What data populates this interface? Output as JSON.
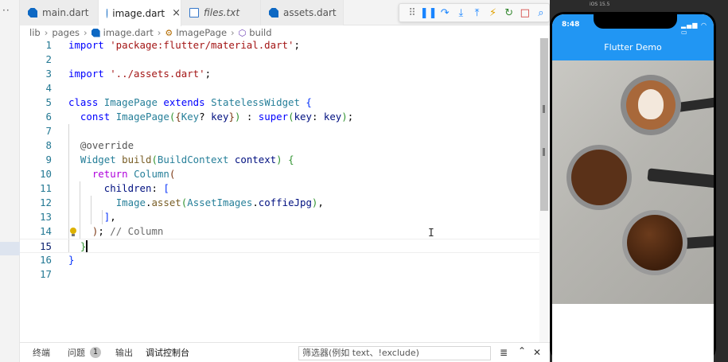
{
  "activity_bar": {
    "more": "··"
  },
  "tabs": [
    {
      "label": "main.dart",
      "icon": "dart-icon",
      "active": false,
      "italic": false
    },
    {
      "label": "image.dart",
      "icon": "dart-icon",
      "active": true,
      "italic": false,
      "close": "×"
    },
    {
      "label": "files.txt",
      "icon": "file-icon",
      "active": false,
      "italic": true
    },
    {
      "label": "assets.dart",
      "icon": "dart-icon",
      "active": false,
      "italic": false
    }
  ],
  "debug_toolbar": {
    "buttons": [
      {
        "name": "drag-handle-icon",
        "glyph": "⠿",
        "color": "#888888"
      },
      {
        "name": "pause-icon",
        "glyph": "❚❚",
        "color": "#1a85ff"
      },
      {
        "name": "step-over-icon",
        "glyph": "↷",
        "color": "#1a85ff"
      },
      {
        "name": "step-into-icon",
        "glyph": "⤓",
        "color": "#1a85ff"
      },
      {
        "name": "step-out-icon",
        "glyph": "⤒",
        "color": "#1a85ff"
      },
      {
        "name": "hot-reload-icon",
        "glyph": "⚡",
        "color": "#e0a000"
      },
      {
        "name": "restart-icon",
        "glyph": "↻",
        "color": "#388a34"
      },
      {
        "name": "stop-icon",
        "glyph": "□",
        "color": "#d0312d"
      },
      {
        "name": "inspect-icon",
        "glyph": "⌕",
        "color": "#1a85ff"
      }
    ]
  },
  "breadcrumb": {
    "items": [
      "lib",
      "pages",
      "image.dart",
      "ImagePage",
      "build"
    ],
    "separator": "›"
  },
  "code_lines": [
    {
      "num": "1",
      "tokens": [
        {
          "t": "import ",
          "c": "kw"
        },
        {
          "t": "'package:flutter/material.dart'",
          "c": "str"
        },
        {
          "t": ";",
          "c": ""
        }
      ]
    },
    {
      "num": "2",
      "tokens": []
    },
    {
      "num": "3",
      "tokens": [
        {
          "t": "import ",
          "c": "kw"
        },
        {
          "t": "'../assets.dart'",
          "c": "str"
        },
        {
          "t": ";",
          "c": ""
        }
      ]
    },
    {
      "num": "4",
      "tokens": []
    },
    {
      "num": "5",
      "tokens": [
        {
          "t": "class ",
          "c": "kw"
        },
        {
          "t": "ImagePage ",
          "c": "ty"
        },
        {
          "t": "extends ",
          "c": "kw"
        },
        {
          "t": "StatelessWidget ",
          "c": "ty"
        },
        {
          "t": "{",
          "c": "br1"
        }
      ]
    },
    {
      "num": "6",
      "tokens": [
        {
          "t": "  ",
          "c": ""
        },
        {
          "t": "const ",
          "c": "kw"
        },
        {
          "t": "ImagePage",
          "c": "ty"
        },
        {
          "t": "(",
          "c": "br2"
        },
        {
          "t": "{",
          "c": "br3"
        },
        {
          "t": "Key",
          "c": "ty"
        },
        {
          "t": "? ",
          "c": ""
        },
        {
          "t": "key",
          "c": "pm"
        },
        {
          "t": "}",
          "c": "br3"
        },
        {
          "t": ")",
          "c": "br2"
        },
        {
          "t": " : ",
          "c": ""
        },
        {
          "t": "super",
          "c": "kw"
        },
        {
          "t": "(",
          "c": "br2"
        },
        {
          "t": "key",
          "c": "pm"
        },
        {
          "t": ": ",
          "c": ""
        },
        {
          "t": "key",
          "c": "pm"
        },
        {
          "t": ")",
          "c": "br2"
        },
        {
          "t": ";",
          "c": ""
        }
      ]
    },
    {
      "num": "7",
      "tokens": []
    },
    {
      "num": "8",
      "tokens": [
        {
          "t": "  ",
          "c": ""
        },
        {
          "t": "@override",
          "c": "ann"
        }
      ]
    },
    {
      "num": "9",
      "tokens": [
        {
          "t": "  ",
          "c": ""
        },
        {
          "t": "Widget ",
          "c": "ty"
        },
        {
          "t": "build",
          "c": "fn"
        },
        {
          "t": "(",
          "c": "br2"
        },
        {
          "t": "BuildContext ",
          "c": "ty"
        },
        {
          "t": "context",
          "c": "pm"
        },
        {
          "t": ")",
          "c": "br2"
        },
        {
          "t": " ",
          "c": ""
        },
        {
          "t": "{",
          "c": "br2"
        }
      ]
    },
    {
      "num": "10",
      "tokens": [
        {
          "t": "    ",
          "c": ""
        },
        {
          "t": "return ",
          "c": "ctl"
        },
        {
          "t": "Column",
          "c": "ty"
        },
        {
          "t": "(",
          "c": "br3"
        }
      ]
    },
    {
      "num": "11",
      "tokens": [
        {
          "t": "      ",
          "c": ""
        },
        {
          "t": "children",
          "c": "pm"
        },
        {
          "t": ": ",
          "c": ""
        },
        {
          "t": "[",
          "c": "br1"
        }
      ]
    },
    {
      "num": "12",
      "tokens": [
        {
          "t": "        ",
          "c": ""
        },
        {
          "t": "Image",
          "c": "ty"
        },
        {
          "t": ".",
          "c": ""
        },
        {
          "t": "asset",
          "c": "fn"
        },
        {
          "t": "(",
          "c": "br2"
        },
        {
          "t": "AssetImages",
          "c": "ty"
        },
        {
          "t": ".",
          "c": ""
        },
        {
          "t": "coffieJpg",
          "c": "pm"
        },
        {
          "t": ")",
          "c": "br2"
        },
        {
          "t": ",",
          "c": ""
        }
      ]
    },
    {
      "num": "13",
      "tokens": [
        {
          "t": "      ",
          "c": ""
        },
        {
          "t": "]",
          "c": "br1"
        },
        {
          "t": ",",
          "c": ""
        }
      ]
    },
    {
      "num": "14",
      "tokens": [
        {
          "t": "    ",
          "c": ""
        },
        {
          "t": ")",
          "c": "br3"
        },
        {
          "t": "; ",
          "c": ""
        },
        {
          "t": "// Column",
          "c": "cm"
        }
      ]
    },
    {
      "num": "15",
      "tokens": [
        {
          "t": "  ",
          "c": ""
        },
        {
          "t": "}",
          "c": "br2"
        }
      ],
      "current": true,
      "caret": true
    },
    {
      "num": "16",
      "tokens": [
        {
          "t": "}",
          "c": "br1"
        }
      ]
    },
    {
      "num": "17",
      "tokens": []
    }
  ],
  "panel": {
    "tabs": [
      {
        "label": "终端",
        "active": false
      },
      {
        "label": "问题",
        "active": false,
        "badge": "1"
      },
      {
        "label": "输出",
        "active": false
      },
      {
        "label": "调试控制台",
        "active": true
      }
    ],
    "filter_placeholder": "筛选器(例如 text、!exclude)",
    "icons": {
      "word_wrap": "≣",
      "collapse": "⌃",
      "close": "✕"
    }
  },
  "simulator": {
    "window_label": "iOS 15.5",
    "status_time": "8:48",
    "status_icons": "▂▄▆ ◠ ▭",
    "app_title": "Flutter Demo",
    "appbar_color": "#2196f3"
  }
}
